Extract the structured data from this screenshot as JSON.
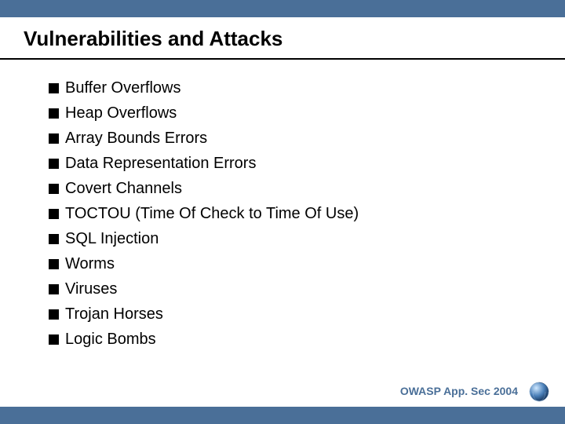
{
  "slide": {
    "title": "Vulnerabilities and Attacks",
    "bullets": [
      "Buffer Overflows",
      "Heap Overflows",
      "Array Bounds Errors",
      "Data Representation Errors",
      "Covert Channels",
      "TOCTOU (Time Of Check to Time Of Use)",
      "SQL Injection",
      "Worms",
      "Viruses",
      "Trojan Horses",
      "Logic Bombs"
    ],
    "footer": "OWASP App. Sec 2004"
  }
}
